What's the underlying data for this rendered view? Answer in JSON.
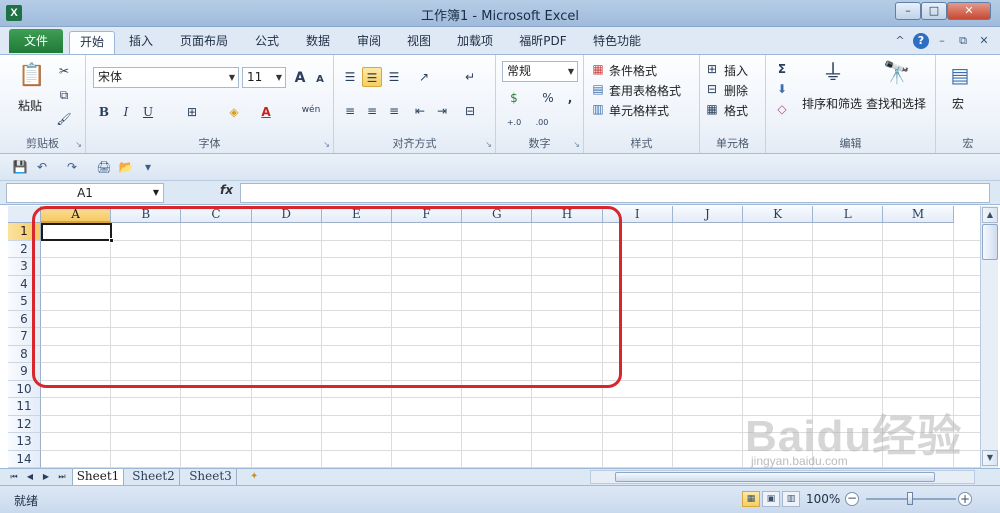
{
  "window": {
    "title": "工作簿1 - Microsoft Excel",
    "app_icon": "X",
    "min": "–",
    "max": "□",
    "close": "✕"
  },
  "ribbon_tabs": {
    "file": "文件",
    "items": [
      "开始",
      "插入",
      "页面布局",
      "公式",
      "数据",
      "审阅",
      "视图",
      "加载项",
      "福昕PDF",
      "特色功能"
    ],
    "active": 0
  },
  "ribbon": {
    "clipboard": {
      "label": "剪贴板",
      "paste": "粘贴"
    },
    "font": {
      "label": "字体",
      "font_name": "宋体",
      "font_size": "11",
      "grow": "A",
      "shrink": "A",
      "bold": "B",
      "italic": "I",
      "underline": "U",
      "font_color": "A",
      "wen": "wén"
    },
    "alignment": {
      "label": "对齐方式"
    },
    "number": {
      "label": "数字",
      "format": "常规",
      "percent": "%",
      "comma": ",",
      "inc": "+.0",
      "dec": ".00"
    },
    "styles": {
      "label": "样式",
      "conditional": "条件格式",
      "table": "套用表格格式",
      "cell": "单元格样式"
    },
    "cells": {
      "label": "单元格",
      "insert": "插入",
      "delete": "删除",
      "format": "格式"
    },
    "editing": {
      "label": "编辑",
      "sigma": "Σ",
      "sort": "排序和筛选",
      "find": "查找和选择"
    },
    "macros": {
      "label": "宏",
      "macro": "宏"
    }
  },
  "formula_bar": {
    "name_box": "A1",
    "fx": "fx",
    "value": ""
  },
  "grid": {
    "columns": [
      "A",
      "B",
      "C",
      "D",
      "E",
      "F",
      "G",
      "H",
      "I",
      "J",
      "K",
      "L",
      "M"
    ],
    "rows": [
      "1",
      "2",
      "3",
      "4",
      "5",
      "6",
      "7",
      "8",
      "9",
      "10",
      "11",
      "12",
      "13",
      "14"
    ],
    "selected_cell": "A1"
  },
  "sheets": {
    "tabs": [
      "Sheet1",
      "Sheet2",
      "Sheet3"
    ],
    "active": 0
  },
  "status": {
    "text": "就绪",
    "zoom": "100%",
    "zoom_fraction": 0.5
  },
  "watermark": {
    "logo": "Baidu经验",
    "url": "jingyan.baidu.com"
  },
  "colors": {
    "file_tab": "#1f7a38",
    "highlight": "#d9262c",
    "selected_header": "#f6c963"
  }
}
